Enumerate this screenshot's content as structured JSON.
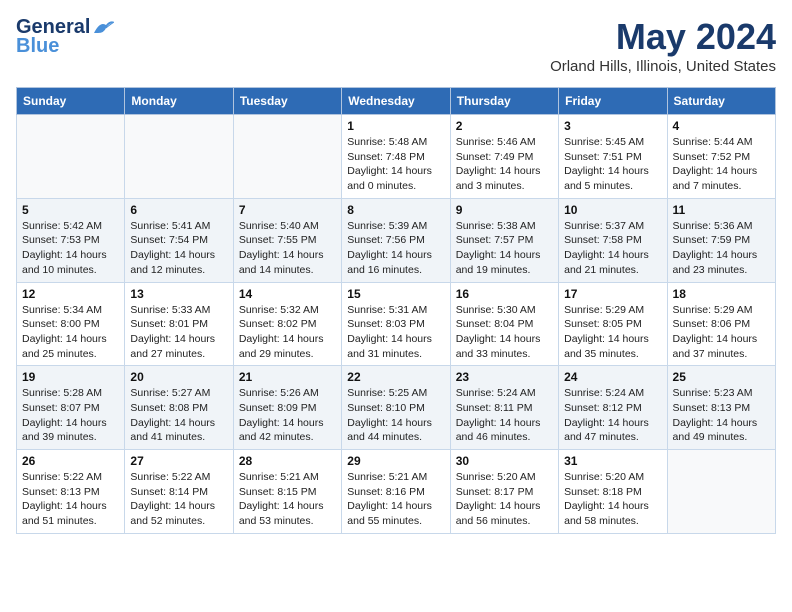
{
  "app": {
    "name_general": "General",
    "name_blue": "Blue"
  },
  "title": "May 2024",
  "location": "Orland Hills, Illinois, United States",
  "days_of_week": [
    "Sunday",
    "Monday",
    "Tuesday",
    "Wednesday",
    "Thursday",
    "Friday",
    "Saturday"
  ],
  "weeks": [
    [
      {
        "day": "",
        "info": ""
      },
      {
        "day": "",
        "info": ""
      },
      {
        "day": "",
        "info": ""
      },
      {
        "day": "1",
        "info": "Sunrise: 5:48 AM\nSunset: 7:48 PM\nDaylight: 14 hours\nand 0 minutes."
      },
      {
        "day": "2",
        "info": "Sunrise: 5:46 AM\nSunset: 7:49 PM\nDaylight: 14 hours\nand 3 minutes."
      },
      {
        "day": "3",
        "info": "Sunrise: 5:45 AM\nSunset: 7:51 PM\nDaylight: 14 hours\nand 5 minutes."
      },
      {
        "day": "4",
        "info": "Sunrise: 5:44 AM\nSunset: 7:52 PM\nDaylight: 14 hours\nand 7 minutes."
      }
    ],
    [
      {
        "day": "5",
        "info": "Sunrise: 5:42 AM\nSunset: 7:53 PM\nDaylight: 14 hours\nand 10 minutes."
      },
      {
        "day": "6",
        "info": "Sunrise: 5:41 AM\nSunset: 7:54 PM\nDaylight: 14 hours\nand 12 minutes."
      },
      {
        "day": "7",
        "info": "Sunrise: 5:40 AM\nSunset: 7:55 PM\nDaylight: 14 hours\nand 14 minutes."
      },
      {
        "day": "8",
        "info": "Sunrise: 5:39 AM\nSunset: 7:56 PM\nDaylight: 14 hours\nand 16 minutes."
      },
      {
        "day": "9",
        "info": "Sunrise: 5:38 AM\nSunset: 7:57 PM\nDaylight: 14 hours\nand 19 minutes."
      },
      {
        "day": "10",
        "info": "Sunrise: 5:37 AM\nSunset: 7:58 PM\nDaylight: 14 hours\nand 21 minutes."
      },
      {
        "day": "11",
        "info": "Sunrise: 5:36 AM\nSunset: 7:59 PM\nDaylight: 14 hours\nand 23 minutes."
      }
    ],
    [
      {
        "day": "12",
        "info": "Sunrise: 5:34 AM\nSunset: 8:00 PM\nDaylight: 14 hours\nand 25 minutes."
      },
      {
        "day": "13",
        "info": "Sunrise: 5:33 AM\nSunset: 8:01 PM\nDaylight: 14 hours\nand 27 minutes."
      },
      {
        "day": "14",
        "info": "Sunrise: 5:32 AM\nSunset: 8:02 PM\nDaylight: 14 hours\nand 29 minutes."
      },
      {
        "day": "15",
        "info": "Sunrise: 5:31 AM\nSunset: 8:03 PM\nDaylight: 14 hours\nand 31 minutes."
      },
      {
        "day": "16",
        "info": "Sunrise: 5:30 AM\nSunset: 8:04 PM\nDaylight: 14 hours\nand 33 minutes."
      },
      {
        "day": "17",
        "info": "Sunrise: 5:29 AM\nSunset: 8:05 PM\nDaylight: 14 hours\nand 35 minutes."
      },
      {
        "day": "18",
        "info": "Sunrise: 5:29 AM\nSunset: 8:06 PM\nDaylight: 14 hours\nand 37 minutes."
      }
    ],
    [
      {
        "day": "19",
        "info": "Sunrise: 5:28 AM\nSunset: 8:07 PM\nDaylight: 14 hours\nand 39 minutes."
      },
      {
        "day": "20",
        "info": "Sunrise: 5:27 AM\nSunset: 8:08 PM\nDaylight: 14 hours\nand 41 minutes."
      },
      {
        "day": "21",
        "info": "Sunrise: 5:26 AM\nSunset: 8:09 PM\nDaylight: 14 hours\nand 42 minutes."
      },
      {
        "day": "22",
        "info": "Sunrise: 5:25 AM\nSunset: 8:10 PM\nDaylight: 14 hours\nand 44 minutes."
      },
      {
        "day": "23",
        "info": "Sunrise: 5:24 AM\nSunset: 8:11 PM\nDaylight: 14 hours\nand 46 minutes."
      },
      {
        "day": "24",
        "info": "Sunrise: 5:24 AM\nSunset: 8:12 PM\nDaylight: 14 hours\nand 47 minutes."
      },
      {
        "day": "25",
        "info": "Sunrise: 5:23 AM\nSunset: 8:13 PM\nDaylight: 14 hours\nand 49 minutes."
      }
    ],
    [
      {
        "day": "26",
        "info": "Sunrise: 5:22 AM\nSunset: 8:13 PM\nDaylight: 14 hours\nand 51 minutes."
      },
      {
        "day": "27",
        "info": "Sunrise: 5:22 AM\nSunset: 8:14 PM\nDaylight: 14 hours\nand 52 minutes."
      },
      {
        "day": "28",
        "info": "Sunrise: 5:21 AM\nSunset: 8:15 PM\nDaylight: 14 hours\nand 53 minutes."
      },
      {
        "day": "29",
        "info": "Sunrise: 5:21 AM\nSunset: 8:16 PM\nDaylight: 14 hours\nand 55 minutes."
      },
      {
        "day": "30",
        "info": "Sunrise: 5:20 AM\nSunset: 8:17 PM\nDaylight: 14 hours\nand 56 minutes."
      },
      {
        "day": "31",
        "info": "Sunrise: 5:20 AM\nSunset: 8:18 PM\nDaylight: 14 hours\nand 58 minutes."
      },
      {
        "day": "",
        "info": ""
      }
    ]
  ]
}
